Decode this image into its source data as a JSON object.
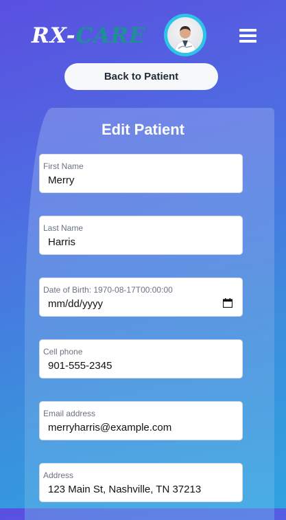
{
  "header": {
    "logo_part1": "RX-",
    "logo_part2": "CARE",
    "avatar_icon": "doctor-avatar",
    "menu_icon": "hamburger-menu-icon"
  },
  "back_button": {
    "label": "Back to Patient"
  },
  "form": {
    "title": "Edit Patient",
    "fields": [
      {
        "label": "First Name",
        "value": "Merry"
      },
      {
        "label": "Last Name",
        "value": "Harris"
      },
      {
        "label": "Date of Birth: 1970-08-17T00:00:00",
        "value": "mm/dd/yyyy",
        "icon": "calendar-icon"
      },
      {
        "label": "Cell phone",
        "value": "901-555-2345"
      },
      {
        "label": "Email address",
        "value": "merryharris@example.com"
      },
      {
        "label": "Address",
        "value": "123 Main St, Nashville, TN 37213"
      }
    ]
  },
  "colors": {
    "logo_accent": "#1f8f95",
    "avatar_ring": "#2ec4e8"
  }
}
